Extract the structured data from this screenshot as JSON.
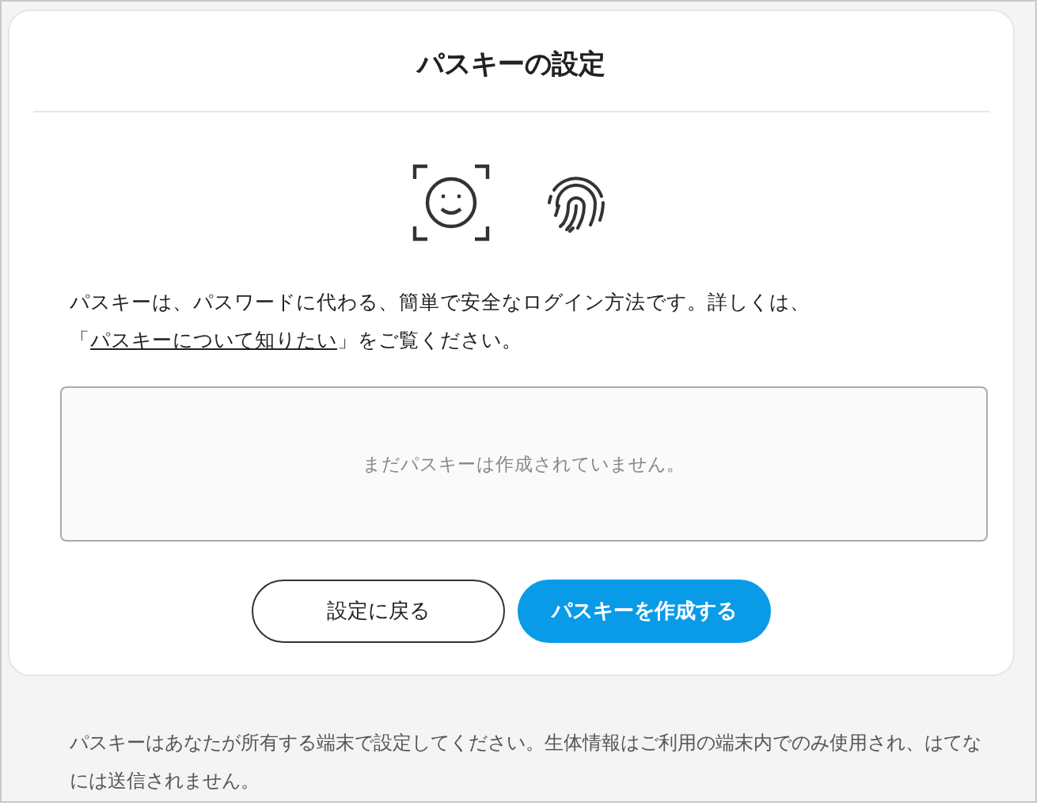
{
  "dialog": {
    "title": "パスキーの設定",
    "intro": {
      "before": "パスキーは、パスワードに代わる、簡単で安全なログイン方法です。詳しくは、「",
      "link": "パスキーについて知りたい",
      "after": "」をご覧ください。"
    },
    "empty_message": "まだパスキーは作成されていません。",
    "buttons": [
      {
        "label": "設定に戻る",
        "kind": "secondary"
      },
      {
        "label": "パスキーを作成する",
        "kind": "primary"
      }
    ]
  },
  "footer_note": "パスキーはあなたが所有する端末で設定してください。生体情報はご利用の端末内でのみ使用され、はてなには送信されません。"
}
